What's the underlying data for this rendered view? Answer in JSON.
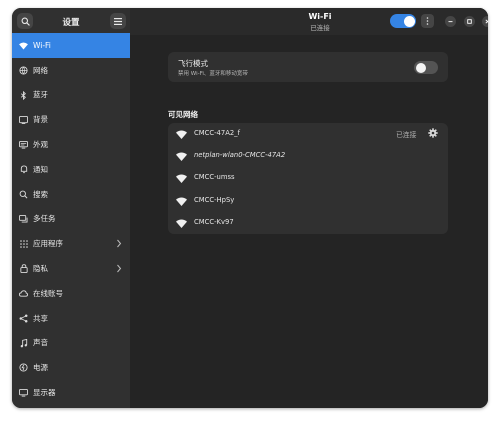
{
  "sidebar": {
    "title": "设置",
    "items": [
      {
        "label": "Wi-Fi",
        "icon": "wifi-icon",
        "active": true
      },
      {
        "label": "网络",
        "icon": "network-icon"
      },
      {
        "label": "蓝牙",
        "icon": "bluetooth-icon"
      },
      {
        "label": "背景",
        "icon": "background-icon"
      },
      {
        "label": "外观",
        "icon": "appearance-icon"
      },
      {
        "label": "通知",
        "icon": "bell-icon"
      },
      {
        "label": "搜索",
        "icon": "search-icon"
      },
      {
        "label": "多任务",
        "icon": "multitasking-icon"
      },
      {
        "label": "应用程序",
        "icon": "apps-grid-icon",
        "has_chevron": true
      },
      {
        "label": "隐私",
        "icon": "lock-icon",
        "has_chevron": true
      },
      {
        "label": "在线账号",
        "icon": "cloud-icon"
      },
      {
        "label": "共享",
        "icon": "share-icon"
      },
      {
        "label": "声音",
        "icon": "music-note-icon"
      },
      {
        "label": "电源",
        "icon": "power-icon"
      },
      {
        "label": "显示器",
        "icon": "display-icon"
      }
    ]
  },
  "header": {
    "title": "Wi-Fi",
    "subtitle": "已连接",
    "wifi_enabled": true
  },
  "airplane": {
    "title": "飞行模式",
    "subtitle": "禁用 Wi-Fi、蓝牙和移动宽带",
    "enabled": false
  },
  "visible_networks": {
    "title": "可见网络",
    "networks": [
      {
        "name": "CMCC-47A2_f",
        "status": "已连接",
        "connected": true,
        "italic": false
      },
      {
        "name": "netplan-wlan0-CMCC-47A2",
        "status": "",
        "connected": false,
        "italic": true
      },
      {
        "name": "CMCC-umss",
        "status": "",
        "connected": false,
        "italic": false
      },
      {
        "name": "CMCC-HpSy",
        "status": "",
        "connected": false,
        "italic": false
      },
      {
        "name": "CMCC-Kv97",
        "status": "",
        "connected": false,
        "italic": false
      }
    ]
  },
  "colors": {
    "accent": "#3584e4",
    "window_bg": "#242424",
    "sidebar_bg": "#303030",
    "card_bg": "#303030"
  }
}
